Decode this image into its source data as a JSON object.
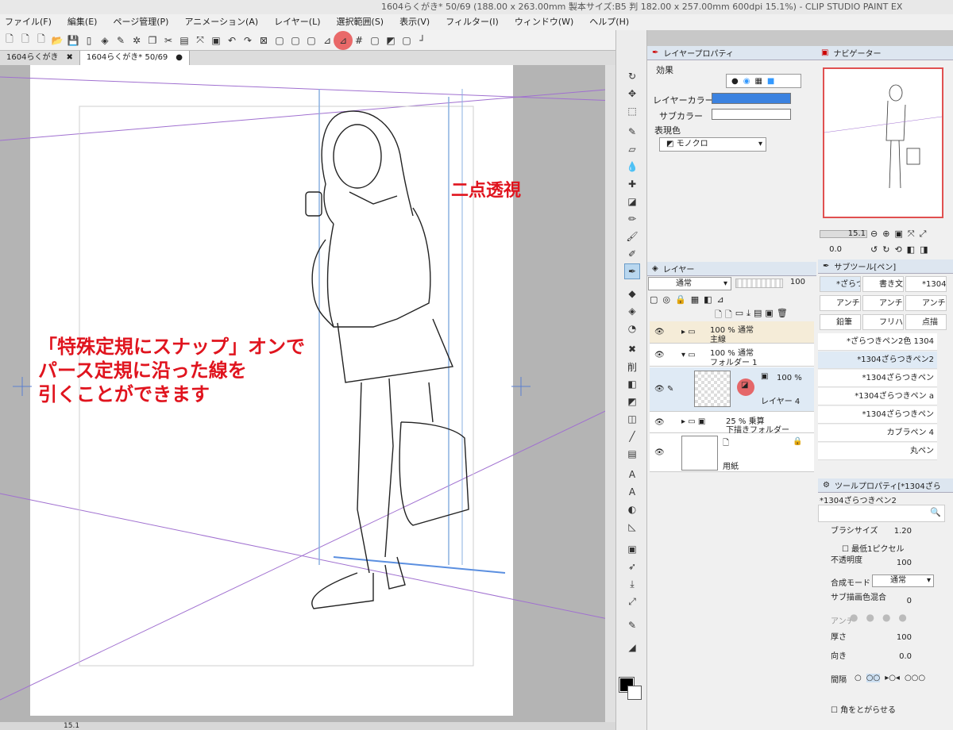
{
  "window": {
    "title": "1604らくがき* 50/69 (188.00 x 263.00mm 製本サイズ:B5 判 182.00 x 257.00mm 600dpi 15.1%) - CLIP STUDIO PAINT EX"
  },
  "menu": [
    "ファイル(F)",
    "編集(E)",
    "ページ管理(P)",
    "アニメーション(A)",
    "レイヤー(L)",
    "選択範囲(S)",
    "表示(V)",
    "フィルター(I)",
    "ウィンドウ(W)",
    "ヘルプ(H)"
  ],
  "tabs": [
    {
      "label": "1604らくがき",
      "close": "✖"
    },
    {
      "label": "1604らくがき* 50/69",
      "close": "●"
    }
  ],
  "canvas": {
    "annotation_title": "二点透視",
    "annotation_lines": [
      "「特殊定規にスナップ」オンで",
      "パース定規に沿った線を",
      "引くことができます"
    ],
    "page_number": "50"
  },
  "status": {
    "zoom": "15.1"
  },
  "layer_property": {
    "tab": "レイヤープロパティ",
    "effect": "効果",
    "layer_color": "レイヤーカラー",
    "sub_color": "サブカラー",
    "expression_color": "表現色",
    "expression_value": "モノクロ",
    "layer_color_hex": "#3b82e0"
  },
  "layers_panel": {
    "tab": "レイヤー",
    "blend_mode": "通常",
    "opacity": "100",
    "layers": [
      {
        "opacity": "100 % 通常",
        "name": "主線"
      },
      {
        "opacity": "100 % 通常",
        "name": "フォルダー 1"
      },
      {
        "opacity": "100 % ",
        "name": "レイヤー 4"
      },
      {
        "opacity": "25 % 乗算",
        "name": "下描きフォルダー"
      },
      {
        "opacity": "",
        "name": "用紙"
      }
    ]
  },
  "navigator": {
    "tab": "ナビゲーター",
    "zoom": "15.1",
    "rotate": "0.0"
  },
  "subtool": {
    "tab": "サブツール[ペン]",
    "items": [
      "*ざらつ",
      "書き文",
      "*1304",
      "アンチ",
      "アンチ",
      "アンチ",
      "鉛筆",
      "フリハン",
      "点描"
    ],
    "brushes": [
      "*ざらつきペン2色 1304",
      "*1304ざらつきペン2",
      "*1304ざらつきペン",
      "*1304ざらつきペン a",
      "*1304ざらつきペン",
      "カブラペン 4",
      "丸ペン"
    ]
  },
  "tool_property": {
    "tab": "ツールプロパティ[*1304ざら",
    "brush_name": "*1304ざらつきペン2",
    "brush_size_label": "ブラシサイズ",
    "brush_size": "1.20",
    "min_pixel": "最低1ピクセル",
    "opacity_label": "不透明度",
    "opacity": "100",
    "blend_label": "合成モード",
    "blend_value": "通常",
    "sub_draw_label": "サブ描画色混合",
    "sub_draw_value": "0",
    "antialias_label": "アンチ",
    "thickness_label": "厚さ",
    "thickness": "100",
    "direction_label": "向き",
    "direction": "0.0",
    "interval_label": "間隔",
    "corner_label": "角をとがらせる"
  }
}
